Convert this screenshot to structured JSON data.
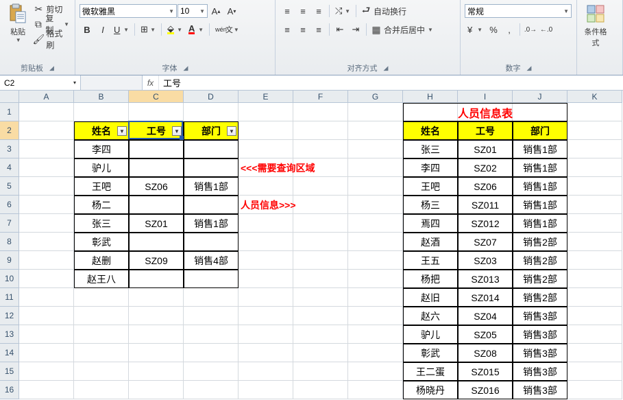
{
  "ribbon": {
    "clipboard": {
      "label": "剪贴板",
      "paste": "粘贴",
      "cut": "剪切",
      "copy": "复制",
      "formatPainter": "格式刷"
    },
    "font": {
      "label": "字体",
      "name": "微软雅黑",
      "size": "10"
    },
    "align": {
      "label": "对齐方式",
      "wrap": "自动换行",
      "merge": "合并后居中"
    },
    "number": {
      "label": "数字",
      "format": "常规"
    },
    "styles": {
      "cond": "条件格式"
    }
  },
  "formula_bar": {
    "cell_ref": "C2",
    "formula": "工号"
  },
  "columns": [
    "A",
    "B",
    "C",
    "D",
    "E",
    "F",
    "G",
    "H",
    "I",
    "J",
    "K"
  ],
  "rows": [
    "1",
    "2",
    "3",
    "4",
    "5",
    "6",
    "7",
    "8",
    "9",
    "10",
    "11",
    "12",
    "13",
    "14",
    "15",
    "16"
  ],
  "labels": {
    "query_note": "<<<需要查询区域",
    "info_note": "人员信息>>>",
    "main_title": "人员信息表"
  },
  "lookup_table": {
    "headers": [
      "姓名",
      "工号",
      "部门"
    ],
    "rows": [
      [
        "李四",
        "",
        ""
      ],
      [
        "驴儿",
        "",
        ""
      ],
      [
        "王吧",
        "SZ06",
        "销售1部"
      ],
      [
        "杨二",
        "",
        ""
      ],
      [
        "张三",
        "SZ01",
        "销售1部"
      ],
      [
        "彰武",
        "",
        ""
      ],
      [
        "赵删",
        "SZ09",
        "销售4部"
      ],
      [
        "赵王八",
        "",
        ""
      ]
    ]
  },
  "master_table": {
    "headers": [
      "姓名",
      "工号",
      "部门"
    ],
    "rows": [
      [
        "张三",
        "SZ01",
        "销售1部"
      ],
      [
        "李四",
        "SZ02",
        "销售1部"
      ],
      [
        "王吧",
        "SZ06",
        "销售1部"
      ],
      [
        "杨三",
        "SZ011",
        "销售1部"
      ],
      [
        "焉四",
        "SZ012",
        "销售1部"
      ],
      [
        "赵酒",
        "SZ07",
        "销售2部"
      ],
      [
        "王五",
        "SZ03",
        "销售2部"
      ],
      [
        "杨把",
        "SZ013",
        "销售2部"
      ],
      [
        "赵旧",
        "SZ014",
        "销售2部"
      ],
      [
        "赵六",
        "SZ04",
        "销售3部"
      ],
      [
        "驴儿",
        "SZ05",
        "销售3部"
      ],
      [
        "彰武",
        "SZ08",
        "销售3部"
      ],
      [
        "王二蛋",
        "SZ015",
        "销售3部"
      ],
      [
        "杨晓丹",
        "SZ016",
        "销售3部"
      ]
    ]
  },
  "active": {
    "col": 2,
    "row": 1
  }
}
